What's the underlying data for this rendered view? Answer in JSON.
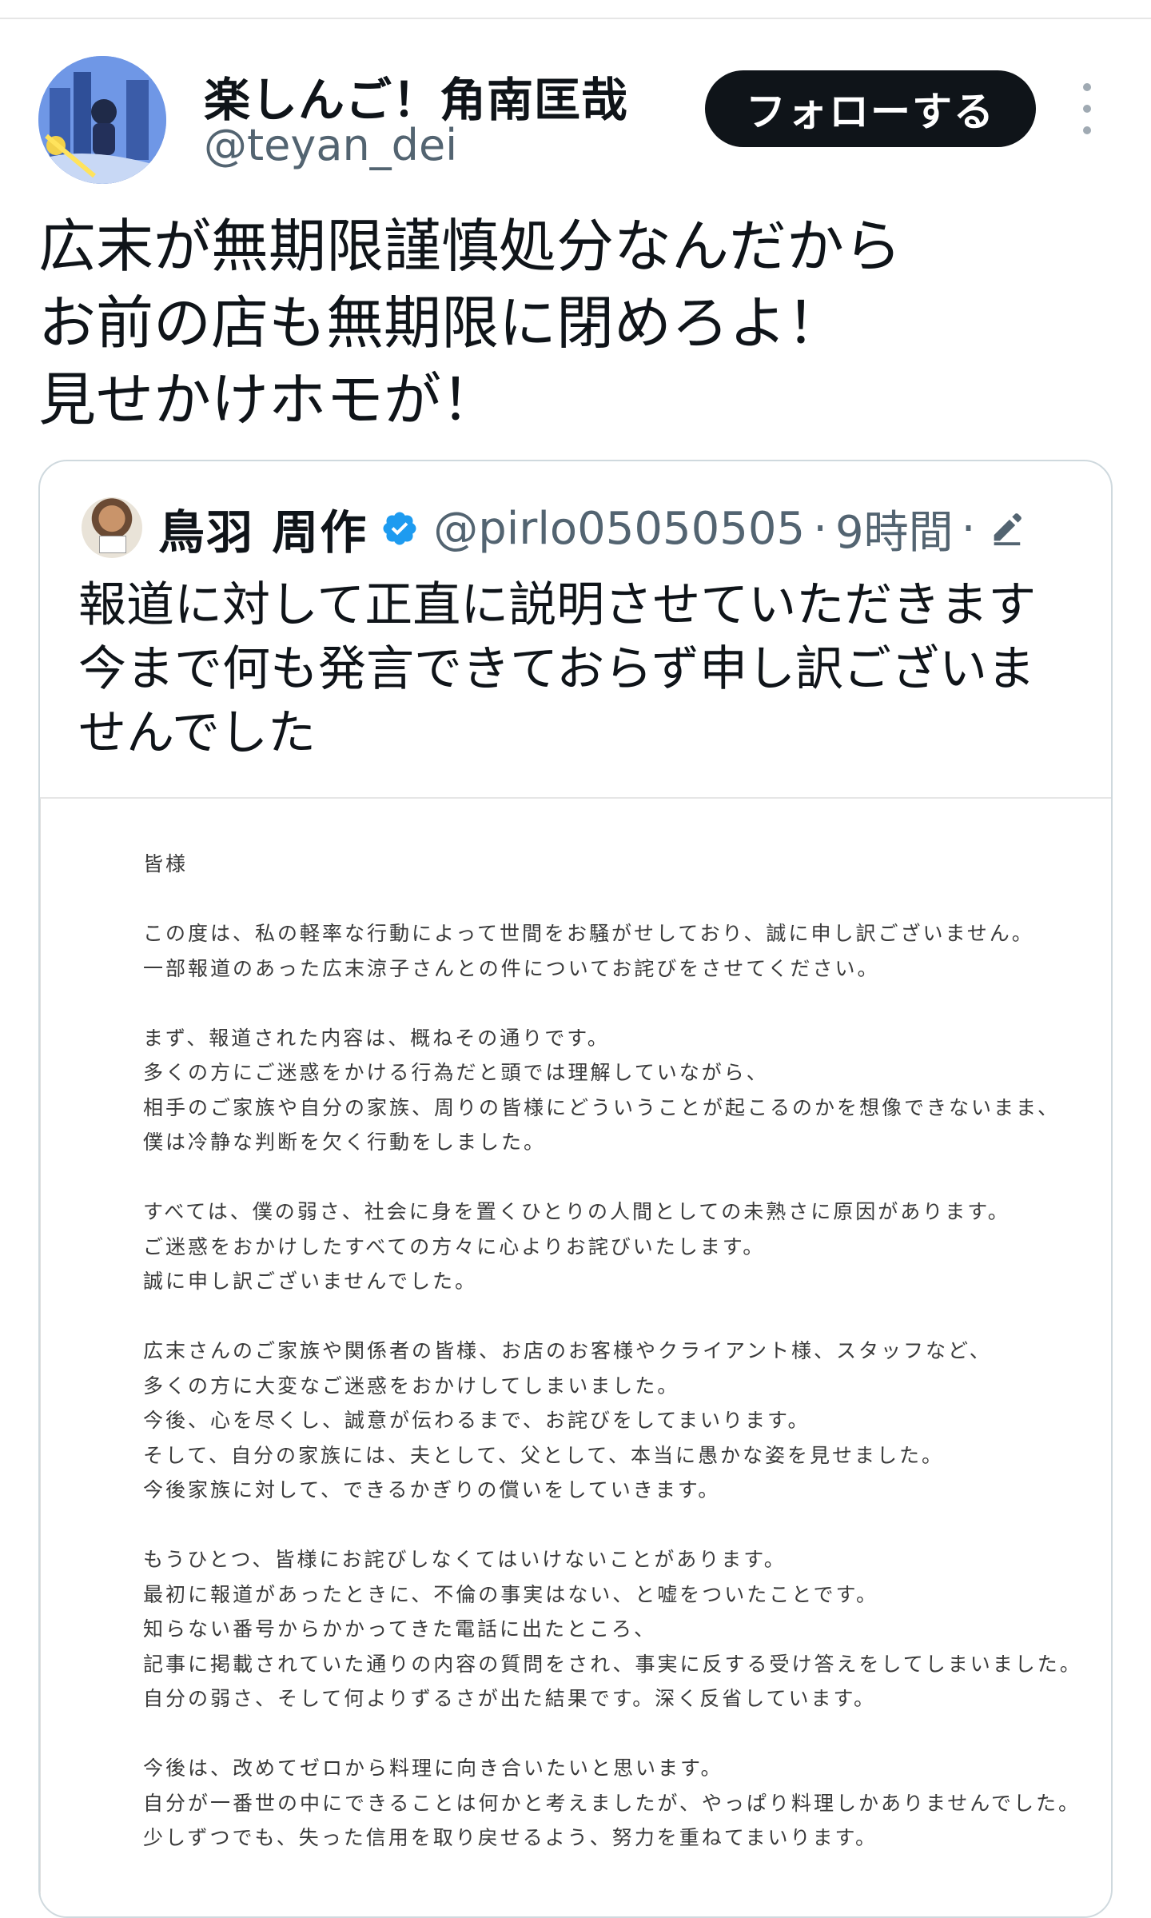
{
  "tweet": {
    "display_name": "楽しんご！角南匡哉",
    "handle": "@teyan_dei",
    "follow_label": "フォローする",
    "avatar_icon": "user-avatar",
    "more_icon": "more-vertical-icon",
    "text": "広末が無期限謹慎処分なんだから\nお前の店も無期限に閉めろよ！\n見せかけホモが！"
  },
  "quote": {
    "name": "鳥羽 周作",
    "handle": "@pirlo05050505",
    "separator": "·",
    "time": "9時間",
    "separator_2": "·",
    "verified_icon": "verified-badge-icon",
    "edit_icon": "edit-pencil-icon",
    "verified_color": "#1d9bf0",
    "text": "報道に対して正直に説明させていただきます\n今まで何も発言できておらず申し訳ございま\nせんでした",
    "letter": {
      "lines": [
        "皆様",
        "",
        "この度は、私の軽率な行動によって世間をお騒がせしており、誠に申し訳ございません。",
        "一部報道のあった広末涼子さんとの件についてお詫びをさせてください。",
        "",
        "まず、報道された内容は、概ねその通りです。",
        "多くの方にご迷惑をかける行為だと頭では理解していながら、",
        "相手のご家族や自分の家族、周りの皆様にどういうことが起こるのかを想像できないまま、",
        "僕は冷静な判断を欠く行動をしました。",
        "",
        "すべては、僕の弱さ、社会に身を置くひとりの人間としての未熟さに原因があります。",
        "ご迷惑をおかけしたすべての方々に心よりお詫びいたします。",
        "誠に申し訳ございませんでした。",
        "",
        "広末さんのご家族や関係者の皆様、お店のお客様やクライアント様、スタッフなど、",
        "多くの方に大変なご迷惑をおかけしてしまいました。",
        "今後、心を尽くし、誠意が伝わるまで、お詫びをしてまいります。",
        "そして、自分の家族には、夫として、父として、本当に愚かな姿を見せました。",
        "今後家族に対して、できるかぎりの償いをしていきます。",
        "",
        "もうひとつ、皆様にお詫びしなくてはいけないことがあります。",
        "最初に報道があったときに、不倫の事実はない、と嘘をついたことです。",
        "知らない番号からかかってきた電話に出たところ、",
        "記事に掲載されていた通りの内容の質問をされ、事実に反する受け答えをしてしまいました。",
        "自分の弱さ、そして何よりずるさが出た結果です。深く反省しています。",
        "",
        "今後は、改めてゼロから料理に向き合いたいと思います。",
        "自分が一番世の中にできることは何かと考えましたが、やっぱり料理しかありませんでした。",
        "少しずつでも、失った信用を取り戻せるよう、努力を重ねてまいります。"
      ]
    }
  }
}
